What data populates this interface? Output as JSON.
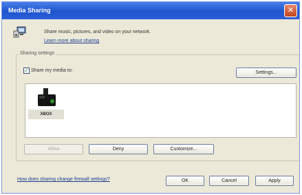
{
  "window": {
    "title": "Media Sharing",
    "close_glyph": "✕"
  },
  "intro": {
    "text": "Share music, pictures, and video on your network.",
    "learn_link": "Learn more about sharing"
  },
  "settings_group": {
    "label": "Sharing settings",
    "share_checkbox_label": "Share my media to:",
    "share_checked": true,
    "settings_button": "Settings..."
  },
  "devices": [
    {
      "name": "XBOX",
      "icon": "media-device-icon",
      "selected": true
    }
  ],
  "device_actions": {
    "allow": "Allow",
    "deny": "Deny",
    "customize": "Customize..."
  },
  "footer": {
    "firewall_link": "How does sharing change firewall settings?",
    "ok": "OK",
    "cancel": "Cancel",
    "apply": "Apply"
  }
}
